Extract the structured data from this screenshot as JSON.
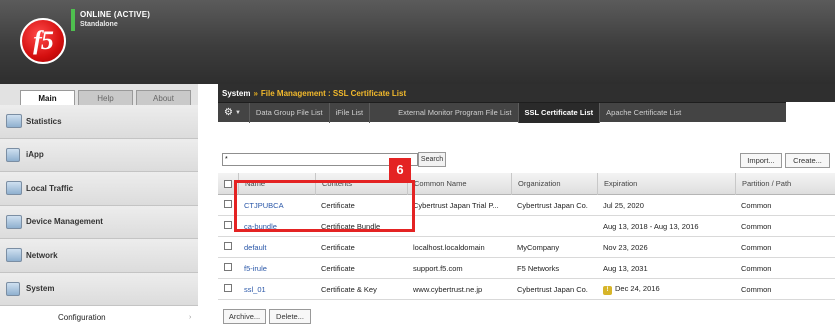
{
  "header": {
    "logo_text": "f5",
    "status": "ONLINE (ACTIVE)",
    "mode": "Standalone"
  },
  "left_tabs": [
    {
      "label": "Main",
      "active": true
    },
    {
      "label": "Help",
      "active": false
    },
    {
      "label": "About",
      "active": false
    }
  ],
  "nav": {
    "items": [
      {
        "label": "Statistics",
        "icon": "statistics-icon"
      },
      {
        "label": "iApp",
        "icon": "iapp-icon"
      },
      {
        "label": "Local Traffic",
        "icon": "local-traffic-icon"
      },
      {
        "label": "Device Management",
        "icon": "device-management-icon"
      },
      {
        "label": "Network",
        "icon": "network-icon"
      },
      {
        "label": "System",
        "icon": "system-icon"
      }
    ],
    "sub_item": "Configuration",
    "sub_arrow": "›"
  },
  "breadcrumb": {
    "root": "System",
    "separator": "»",
    "path": "File Management : SSL Certificate List"
  },
  "subtabs": [
    {
      "label": "Data Group File List",
      "active": false
    },
    {
      "label": "iFile List",
      "active": false
    },
    {
      "label": "External Monitor Program File List",
      "active": false
    },
    {
      "label": "SSL Certificate List",
      "active": true
    },
    {
      "label": "Apache Certificate List",
      "active": false
    }
  ],
  "toolbar": {
    "search_value": "*",
    "search_label": "Search",
    "import_label": "Import...",
    "create_label": "Create..."
  },
  "table": {
    "headers": [
      "Name",
      "Contents",
      "Common Name",
      "Organization",
      "Expiration",
      "Partition / Path"
    ],
    "rows": [
      {
        "name": "CTJPUBCA",
        "contents": "Certificate",
        "common_name": "Cybertrust Japan Trial P...",
        "organization": "Cybertrust Japan Co.",
        "expiration": "Jul 25, 2020",
        "partition": "Common",
        "warn": false
      },
      {
        "name": "ca-bundle",
        "contents": "Certificate Bundle",
        "common_name": "",
        "organization": "",
        "expiration": "Aug 13, 2018 - Aug 13, 2016",
        "partition": "Common",
        "warn": false
      },
      {
        "name": "default",
        "contents": "Certificate",
        "common_name": "localhost.localdomain",
        "organization": "MyCompany",
        "expiration": "Nov 23, 2026",
        "partition": "Common",
        "warn": false
      },
      {
        "name": "f5-irule",
        "contents": "Certificate",
        "common_name": "support.f5.com",
        "organization": "F5 Networks",
        "expiration": "Aug 13, 2031",
        "partition": "Common",
        "warn": false
      },
      {
        "name": "ssl_01",
        "contents": "Certificate & Key",
        "common_name": "www.cybertrust.ne.jp",
        "organization": "Cybertrust Japan Co.",
        "expiration": "Dec 24, 2016",
        "partition": "Common",
        "warn": true
      }
    ]
  },
  "footer": {
    "archive_label": "Archive...",
    "delete_label": "Delete..."
  },
  "annotation": {
    "badge": "6",
    "color": "#e42323"
  },
  "colors": {
    "breadcrumb_path": "#f2b92c",
    "status_green": "#4fc04f",
    "link_blue": "#2a57a8"
  }
}
